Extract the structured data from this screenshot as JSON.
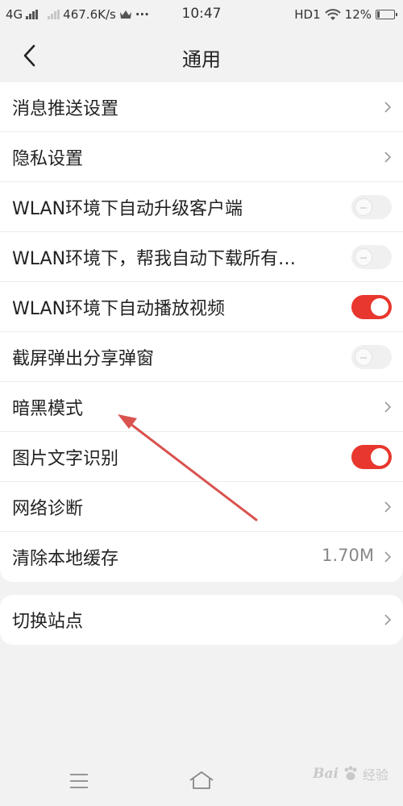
{
  "status_bar": {
    "network": "4G",
    "speed": "467.6K/s",
    "more": "···",
    "time": "10:47",
    "hd": "HD1",
    "battery": "12%"
  },
  "header": {
    "title": "通用",
    "back_icon": "chevron-left-icon"
  },
  "settings": {
    "items": [
      {
        "label": "消息推送设置",
        "control": "chevron"
      },
      {
        "label": "隐私设置",
        "control": "chevron"
      },
      {
        "label": "WLAN环境下自动升级客户端",
        "control": "toggle",
        "state": "off"
      },
      {
        "label": "WLAN环境下，帮我自动下载所有…",
        "control": "toggle",
        "state": "off"
      },
      {
        "label": "WLAN环境下自动播放视频",
        "control": "toggle",
        "state": "on"
      },
      {
        "label": "截屏弹出分享弹窗",
        "control": "toggle",
        "state": "off"
      },
      {
        "label": "暗黑模式",
        "control": "chevron"
      },
      {
        "label": "图片文字识别",
        "control": "toggle",
        "state": "on"
      },
      {
        "label": "网络诊断",
        "control": "chevron"
      },
      {
        "label": "清除本地缓存",
        "control": "chevron",
        "value": "1.70M"
      }
    ]
  },
  "settings2": {
    "items": [
      {
        "label": "切换站点",
        "control": "chevron"
      }
    ]
  },
  "bottom_bar": {
    "watermark_logo": "Bai",
    "watermark_text": "经验"
  },
  "colors": {
    "accent": "#e8372e",
    "annotation_arrow": "#d9534f",
    "background": "#f2f2f2"
  }
}
